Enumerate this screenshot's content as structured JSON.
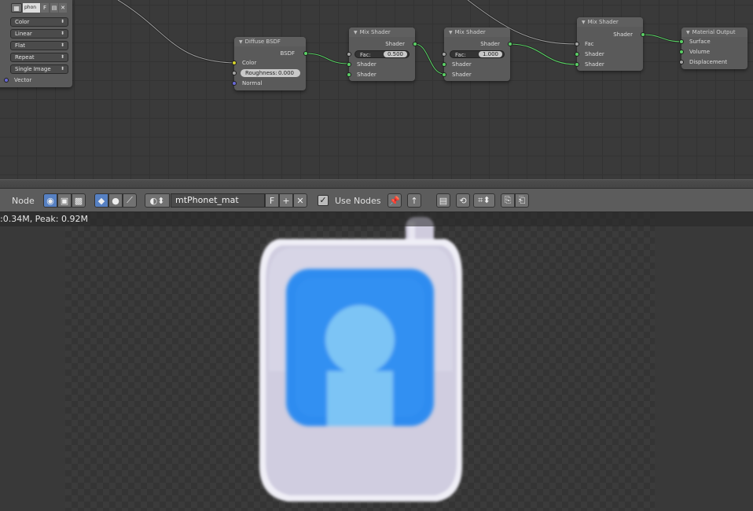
{
  "texture_node": {
    "image_name": "phon",
    "image_flag": "F",
    "options": [
      "Color",
      "Linear",
      "Flat",
      "Repeat",
      "Single Image"
    ],
    "input_label": "Vector"
  },
  "diffuse_node": {
    "title": "Diffuse BSDF",
    "output": "BSDF",
    "inputs": [
      "Color",
      "Normal"
    ],
    "roughness_label": "Roughness:",
    "roughness_value": "0.000"
  },
  "mix1": {
    "title": "Mix Shader",
    "output": "Shader",
    "fac_label": "Fac:",
    "fac_value": "0.500",
    "inputs": [
      "Shader",
      "Shader"
    ]
  },
  "mix2": {
    "title": "Mix Shader",
    "output": "Shader",
    "fac_label": "Fac:",
    "fac_value": "1.000",
    "inputs": [
      "Shader",
      "Shader"
    ]
  },
  "mix3": {
    "title": "Mix Shader",
    "output": "Shader",
    "inputs": [
      "Fac",
      "Shader",
      "Shader"
    ]
  },
  "output_node": {
    "title": "Material Output",
    "inputs": [
      "Surface",
      "Volume",
      "Displacement"
    ]
  },
  "header": {
    "menu_node": "Node",
    "material_name": "mtPhonet_mat",
    "fake_user": "F",
    "use_nodes_checked": true,
    "use_nodes_label": "Use Nodes"
  },
  "stats": {
    "text": ":0.34M, Peak: 0.92M"
  },
  "colors": {
    "accent_active": "#5680c2",
    "socket_shader": "#5bd066",
    "socket_color": "#d6d42d",
    "socket_float": "#a5a5a5",
    "socket_vector": "#6a6ad6",
    "phone_body": "#d0cde0",
    "phone_screen": "#2f8cf0",
    "avatar": "#7cc4f5"
  }
}
